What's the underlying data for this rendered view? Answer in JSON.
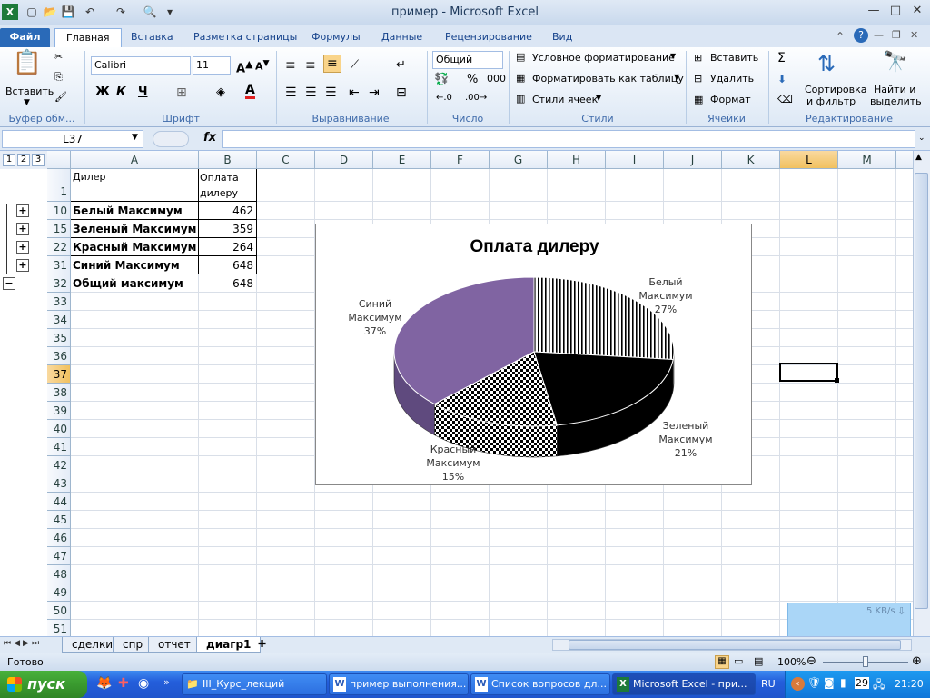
{
  "window": {
    "title": "пример  -  Microsoft Excel",
    "min": "—",
    "max": "□",
    "close": "✕"
  },
  "ribbon_tabs": [
    "Файл",
    "Главная",
    "Вставка",
    "Разметка страницы",
    "Формулы",
    "Данные",
    "Рецензирование",
    "Вид"
  ],
  "ribbon": {
    "clipboard": {
      "paste": "Вставить",
      "label": "Буфер обм..."
    },
    "font": {
      "name": "Calibri",
      "size": "11",
      "bold": "Ж",
      "italic": "К",
      "underline": "Ч",
      "label": "Шрифт"
    },
    "alignment": {
      "label": "Выравнивание"
    },
    "number": {
      "format": "Общий",
      "label": "Число",
      "percent": "%",
      "thousands": "000"
    },
    "styles": {
      "conditional": "Условное форматирование",
      "as_table": "Форматировать как таблицу",
      "cell_styles": "Стили ячеек",
      "label": "Стили"
    },
    "cells": {
      "insert": "Вставить",
      "delete": "Удалить",
      "format": "Формат",
      "label": "Ячейки"
    },
    "editing": {
      "sort": "Сортировка",
      "sort2": "и фильтр",
      "find": "Найти и",
      "find2": "выделить",
      "label": "Редактирование"
    }
  },
  "formula_bar": {
    "name_box": "L37",
    "fx": "fx",
    "formula": ""
  },
  "outline_levels": [
    "1",
    "2",
    "3"
  ],
  "columns": [
    "A",
    "B",
    "C",
    "D",
    "E",
    "F",
    "G",
    "H",
    "I",
    "J",
    "K",
    "L",
    "M"
  ],
  "selected_column": "L",
  "rows": [
    {
      "num": "1",
      "a": "Дилер",
      "b": "Оплата дилеру",
      "bold": false
    },
    {
      "num": "10",
      "a": "Белый Максимум",
      "b": "462",
      "bold": true
    },
    {
      "num": "15",
      "a": "Зеленый Максимум",
      "b": "359",
      "bold": true
    },
    {
      "num": "22",
      "a": "Красный Максимум",
      "b": "264",
      "bold": true
    },
    {
      "num": "31",
      "a": "Синий Максимум",
      "b": "648",
      "bold": true
    },
    {
      "num": "32",
      "a": "Общий максимум",
      "b": "648",
      "bold": true
    }
  ],
  "empty_rows": [
    "33",
    "34",
    "35",
    "36",
    "37",
    "38",
    "39",
    "40",
    "41",
    "42",
    "43",
    "44",
    "45",
    "46",
    "47",
    "48",
    "49",
    "50",
    "51"
  ],
  "selected_row": "37",
  "chart_data": {
    "type": "pie",
    "title": "Оплата дилеру",
    "categories": [
      "Белый Максимум",
      "Зеленый Максимум",
      "Красный Максимум",
      "Синий Максимум"
    ],
    "values": [
      462,
      359,
      264,
      648
    ],
    "percent_labels": [
      "27%",
      "21%",
      "15%",
      "37%"
    ],
    "fills": [
      "vertical-stripes",
      "#000000",
      "checkerboard",
      "#8064a2"
    ]
  },
  "sheet_tabs": [
    "сделки",
    "спр",
    "отчет",
    "диагр1"
  ],
  "active_sheet": "диагр1",
  "status": {
    "ready": "Готово",
    "zoom": "100%"
  },
  "net_widget": {
    "speed": "5 KB/s"
  },
  "taskbar": {
    "start": "пуск",
    "tasks": [
      "III_Курс_лекций",
      "пример выполнения...",
      "Список вопросов дл...",
      "Microsoft Excel - при..."
    ],
    "lang": "RU",
    "clock": "21:20",
    "tray_num": "29"
  }
}
